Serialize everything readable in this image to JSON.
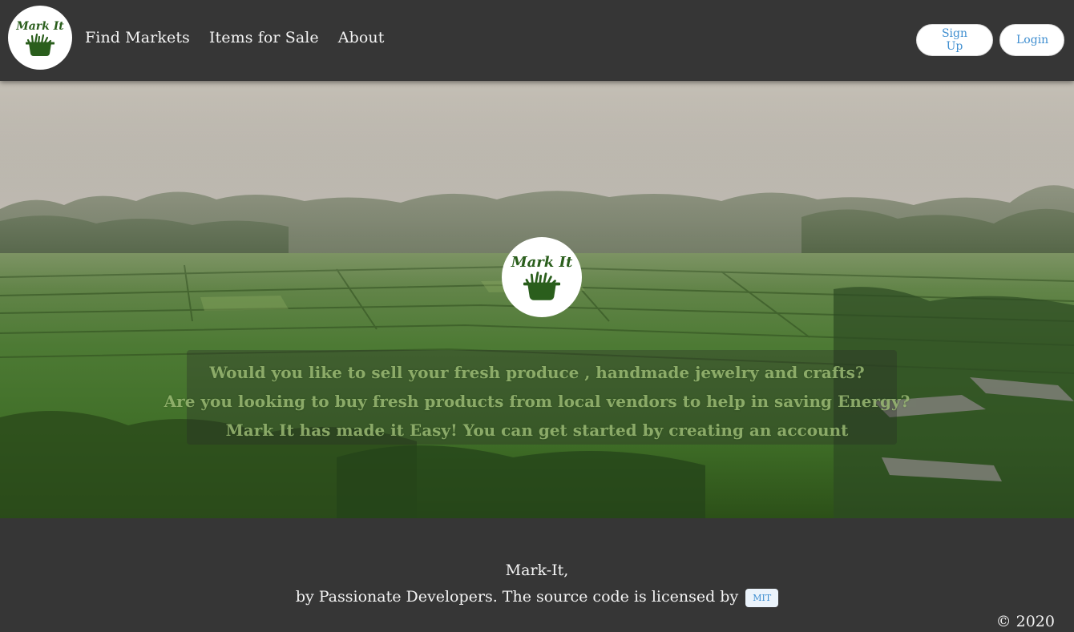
{
  "brand": {
    "logo_text": "Mark It"
  },
  "nav": {
    "links": [
      {
        "label": "Find Markets"
      },
      {
        "label": "Items for Sale"
      },
      {
        "label": "About"
      }
    ],
    "signup_label": "Sign Up",
    "login_label": "Login"
  },
  "hero": {
    "lines": [
      "Would you like to sell your fresh produce , handmade jewelry and crafts?",
      "Are you looking to buy fresh products from local vendors to help in saving Energy?",
      "Mark It has made it Easy! You can get started by creating an account"
    ]
  },
  "footer": {
    "title": "Mark-It,",
    "byline": "by Passionate Developers. The source code is licensed by",
    "license_tag": "MIT",
    "copyright": "© 2020"
  },
  "colors": {
    "navbar_bg": "#363636",
    "logo_green": "#2a5e1c",
    "link_blue": "#3e8ed0",
    "text_light": "#f4f4f4"
  }
}
